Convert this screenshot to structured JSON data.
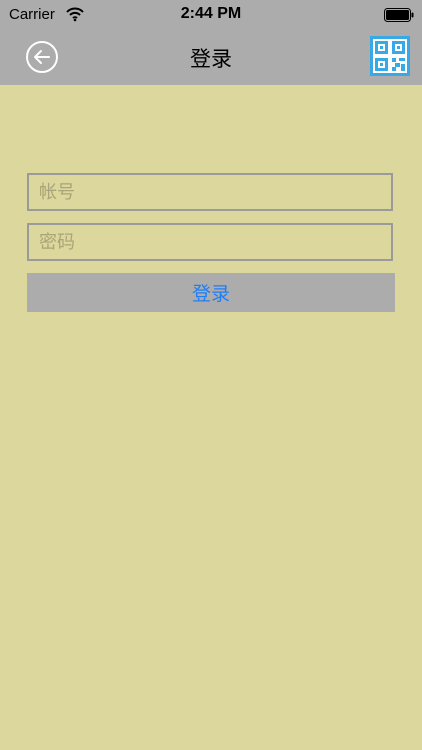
{
  "status_bar": {
    "carrier": "Carrier",
    "time": "2:44 PM"
  },
  "nav": {
    "title": "登录",
    "back_icon": "back-arrow-circle-icon",
    "qr_icon": "qr-code-scan-icon",
    "qr_color": "#39a9e6"
  },
  "form": {
    "account_placeholder": "帐号",
    "account_value": "",
    "password_placeholder": "密码",
    "password_value": "",
    "login_label": "登录",
    "login_text_color": "#1f7ef5"
  },
  "colors": {
    "background": "#dcd79c",
    "bar": "#acacac"
  }
}
